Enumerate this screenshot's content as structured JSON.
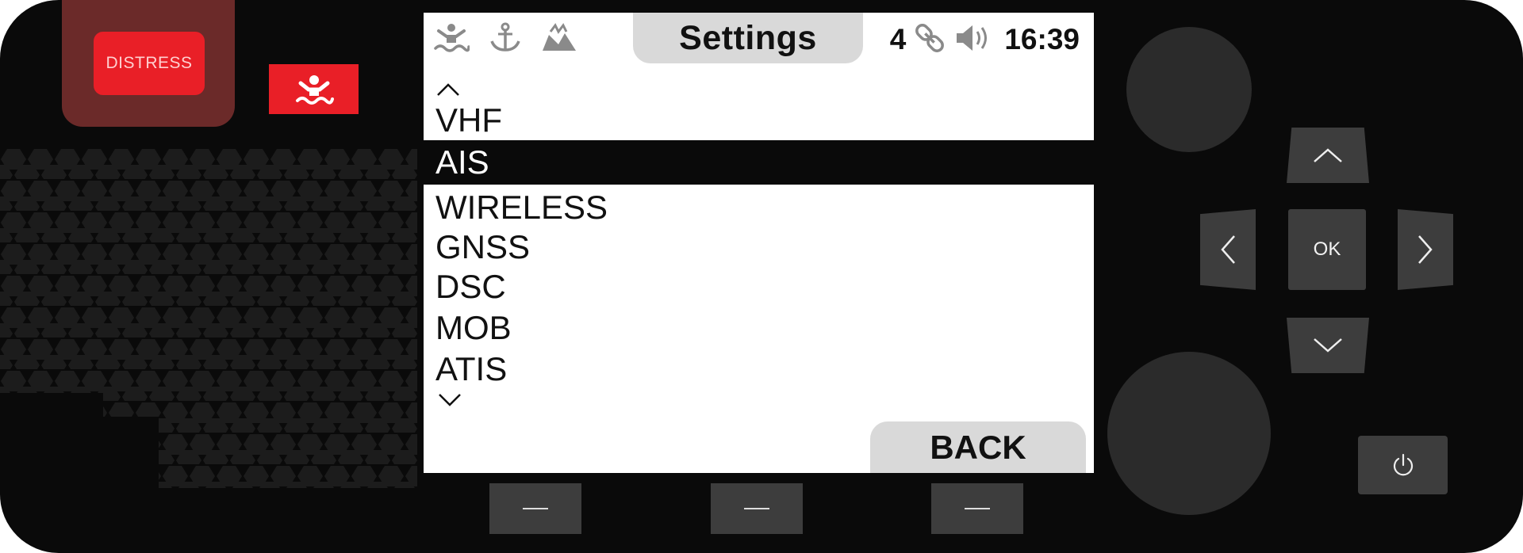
{
  "device": {
    "distress_label": "DISTRESS",
    "mob_icon": "man-overboard-icon"
  },
  "screen": {
    "status_icons": [
      "man-overboard-icon",
      "anchor-icon",
      "shipwreck-icon"
    ],
    "title": "Settings",
    "satellite_count": "4",
    "link_icon": "link-icon",
    "volume_icon": "speaker-volume-icon",
    "time": "16:39",
    "menu": {
      "items": [
        "VHF",
        "AIS",
        "WIRELESS",
        "GNSS",
        "DSC",
        "MOB",
        "ATIS"
      ],
      "selected": "AIS"
    },
    "back_label": "BACK"
  },
  "controls": {
    "ok_label": "OK",
    "power_icon": "power-icon"
  },
  "colors": {
    "distress_red": "#e91f27",
    "body": "#0a0a0a",
    "screen_bg": "#ffffff",
    "highlight": "#0a0a0a",
    "tab_gray": "#d9d9d9",
    "key_gray": "#3d3d3d"
  }
}
